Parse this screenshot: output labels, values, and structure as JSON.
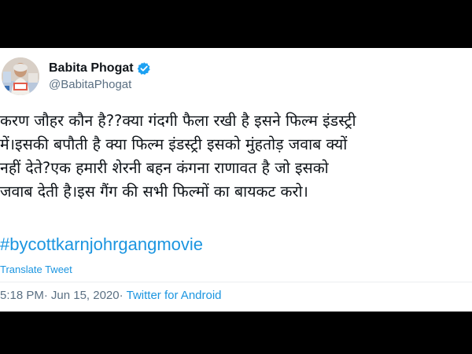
{
  "tweet": {
    "author": {
      "display_name": "Babita Phogat",
      "handle": "@BabitaPhogat",
      "verified": true
    },
    "text_lines": [
      "करण जौहर कौन है??क्या गंदगी फैला रखी है इसने फिल्म इंडस्ट्री",
      "में।इसकी बपौती है क्या फिल्म इंडस्ट्री इसको मुंहतोड़ जवाब क्यों",
      "नहीं देते?एक हमारी शेरनी बहन कंगना राणावत है जो इसको",
      "जवाब देती है।इस गैंग की सभी फिल्मों का बायकट करो।"
    ],
    "hashtag": "#bycottkarnjohrgangmovie",
    "translate_label": "Translate Tweet",
    "meta": {
      "time": "5:18 PM",
      "separator": "·",
      "date": "Jun 15, 2020",
      "source": "Twitter for Android"
    }
  },
  "colors": {
    "text": "#0f1419",
    "secondary": "#5b7083",
    "link": "#1b95e0",
    "verified": "#1da1f2",
    "background_outer": "#000000",
    "card": "#ffffff"
  },
  "icons": {
    "verified": "verified-badge-icon",
    "avatar": "profile-avatar"
  }
}
